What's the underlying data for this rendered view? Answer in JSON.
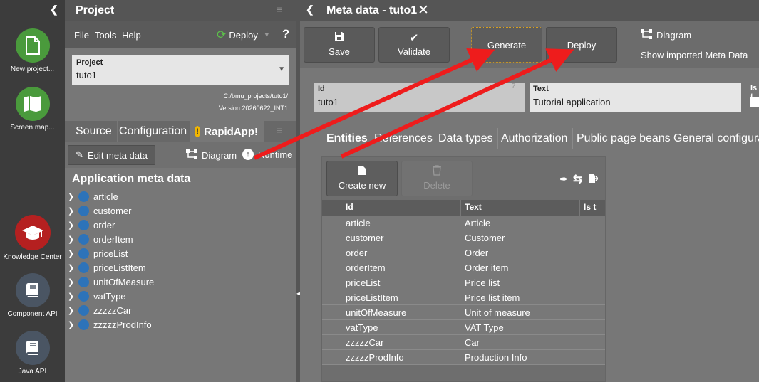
{
  "left_nav": {
    "collapse_icon": "chevron-left",
    "items": [
      {
        "label": "New project...",
        "icon": "file-icon",
        "color": "#4a9a3c"
      },
      {
        "label": "Screen map...",
        "icon": "map-icon",
        "color": "#4a9a3c"
      },
      {
        "label": "Knowledge Center",
        "icon": "graduation-cap-icon",
        "color": "#b52020"
      },
      {
        "label": "Component API",
        "icon": "book-icon",
        "color": "#4a5563"
      },
      {
        "label": "Java API",
        "icon": "book-icon",
        "color": "#4a5563"
      }
    ]
  },
  "project_panel": {
    "title": "Project",
    "menu": {
      "file": "File",
      "tools": "Tools",
      "help": "Help",
      "deploy": "Deploy",
      "help_icon": "?"
    },
    "project_select": {
      "label": "Project",
      "value": "tuto1"
    },
    "path": "C:/bmu_projects/tuto1/",
    "version": "Version  20260622_INT1",
    "tabs": [
      {
        "label": "Source"
      },
      {
        "label": "Configuration"
      },
      {
        "label": "RapidApp!",
        "badge": "!"
      }
    ],
    "toolbar": {
      "edit_meta": "Edit meta data",
      "diagram": "Diagram",
      "runtime": "Runtime"
    },
    "tree_title": "Application meta data",
    "tree_items": [
      "article",
      "customer",
      "order",
      "orderItem",
      "priceList",
      "priceListItem",
      "unitOfMeasure",
      "vatType",
      "zzzzzCar",
      "zzzzzProdInfo"
    ]
  },
  "main": {
    "title": "Meta data - tuto1",
    "toolbar": {
      "save": "Save",
      "validate": "Validate",
      "generate": "Generate",
      "deploy": "Deploy",
      "diagram": "Diagram",
      "show_imported": "Show imported Meta Data"
    },
    "fields": {
      "id_label": "Id",
      "id_value": "tuto1",
      "text_label": "Text",
      "text_value": "Tutorial application",
      "is_label": "Is t"
    },
    "tabs": [
      "Entities",
      "References",
      "Data types",
      "Authorization",
      "Public page beans",
      "General configurati"
    ],
    "grid": {
      "create_new": "Create new",
      "delete": "Delete",
      "columns": [
        "Id",
        "Text",
        "Is t"
      ],
      "rows": [
        {
          "id": "article",
          "text": "Article"
        },
        {
          "id": "customer",
          "text": "Customer"
        },
        {
          "id": "order",
          "text": "Order"
        },
        {
          "id": "orderItem",
          "text": "Order item"
        },
        {
          "id": "priceList",
          "text": "Price list"
        },
        {
          "id": "priceListItem",
          "text": "Price list item"
        },
        {
          "id": "unitOfMeasure",
          "text": "Unit of measure"
        },
        {
          "id": "vatType",
          "text": "VAT Type"
        },
        {
          "id": "zzzzzCar",
          "text": "Car"
        },
        {
          "id": "zzzzzProdInfo",
          "text": "Production Info"
        }
      ]
    }
  },
  "colors": {
    "annotation_arrow": "#ee1c1c",
    "generate_border": "#d8a020"
  }
}
